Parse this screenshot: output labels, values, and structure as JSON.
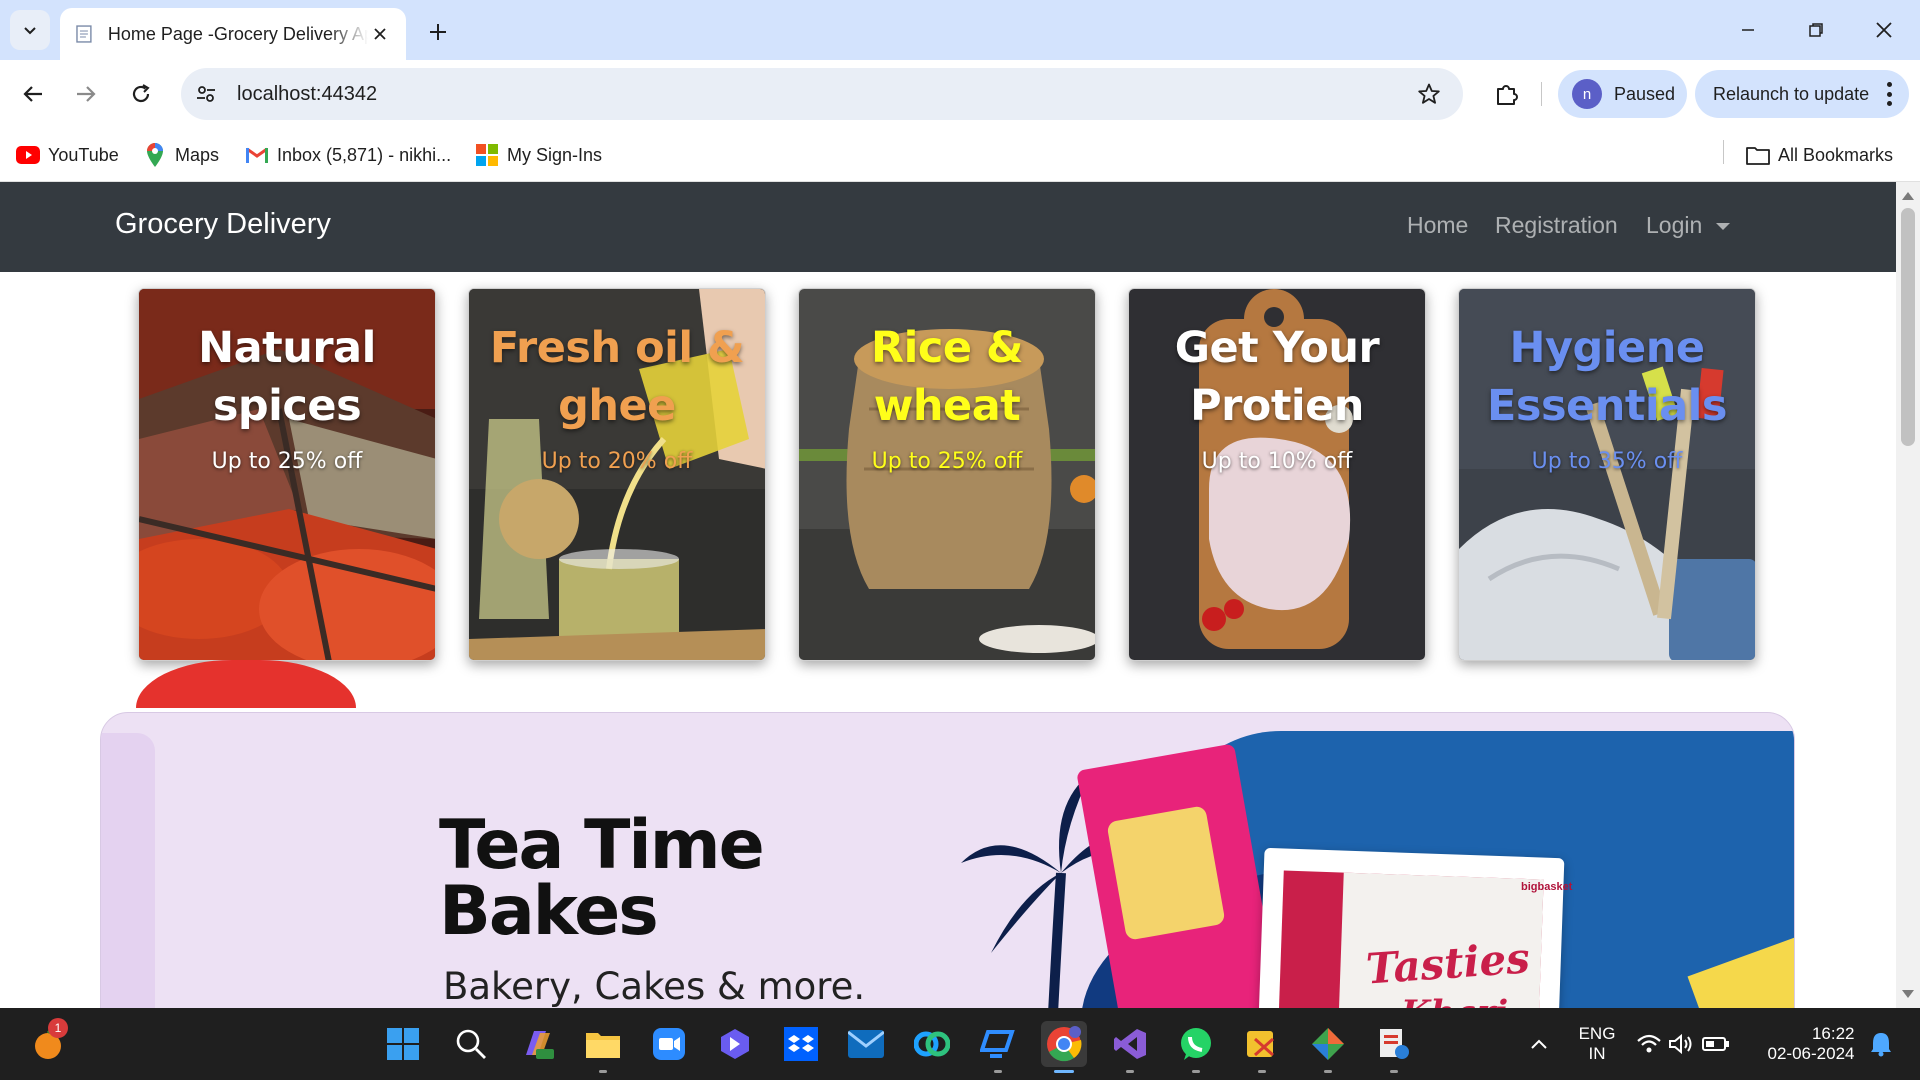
{
  "browser": {
    "tab_title": "Home Page -Grocery Delivery App",
    "url": "localhost:44342",
    "profile_label": "Paused",
    "profile_initial": "n",
    "relaunch_label": "Relaunch to update",
    "bookmarks": [
      {
        "label": "YouTube"
      },
      {
        "label": "Maps"
      },
      {
        "label": "Inbox (5,871) - nikhi..."
      },
      {
        "label": "My Sign-Ins"
      }
    ],
    "all_bookmarks_label": "All Bookmarks"
  },
  "site": {
    "brand": "Grocery Delivery",
    "nav": {
      "home": "Home",
      "registration": "Registration",
      "login": "Login"
    },
    "cards": [
      {
        "title": "Natural spices",
        "offer": "Up to 25% off",
        "title_color": "#ffffff",
        "offer_color": "#ffffff"
      },
      {
        "title": "Fresh oil & ghee",
        "offer": "Up to 20% off",
        "title_color": "#f0a050",
        "offer_color": "#f0a050"
      },
      {
        "title": "Rice & wheat",
        "offer": "Up to 25% off",
        "title_color": "#ffff1a",
        "offer_color": "#ffff1a"
      },
      {
        "title": "Get Your Protien",
        "offer": "Up to 10% off",
        "title_color": "#ffffff",
        "offer_color": "#ffffff"
      },
      {
        "title": "Hygiene Essentials",
        "offer": "Up to 35% off",
        "title_color": "#6a8ff0",
        "offer_color": "#6a8ff0"
      }
    ],
    "banner": {
      "headline_line1": "Tea Time",
      "headline_line2": "Bakes",
      "subtitle": "Bakery, Cakes & more.",
      "brand_small": "bigbasket",
      "product_name": "Tasties",
      "product_sub": "Khari"
    }
  },
  "taskbar": {
    "notification_count": "1",
    "lang_line1": "ENG",
    "lang_line2": "IN",
    "time": "16:22",
    "date": "02-06-2024"
  }
}
